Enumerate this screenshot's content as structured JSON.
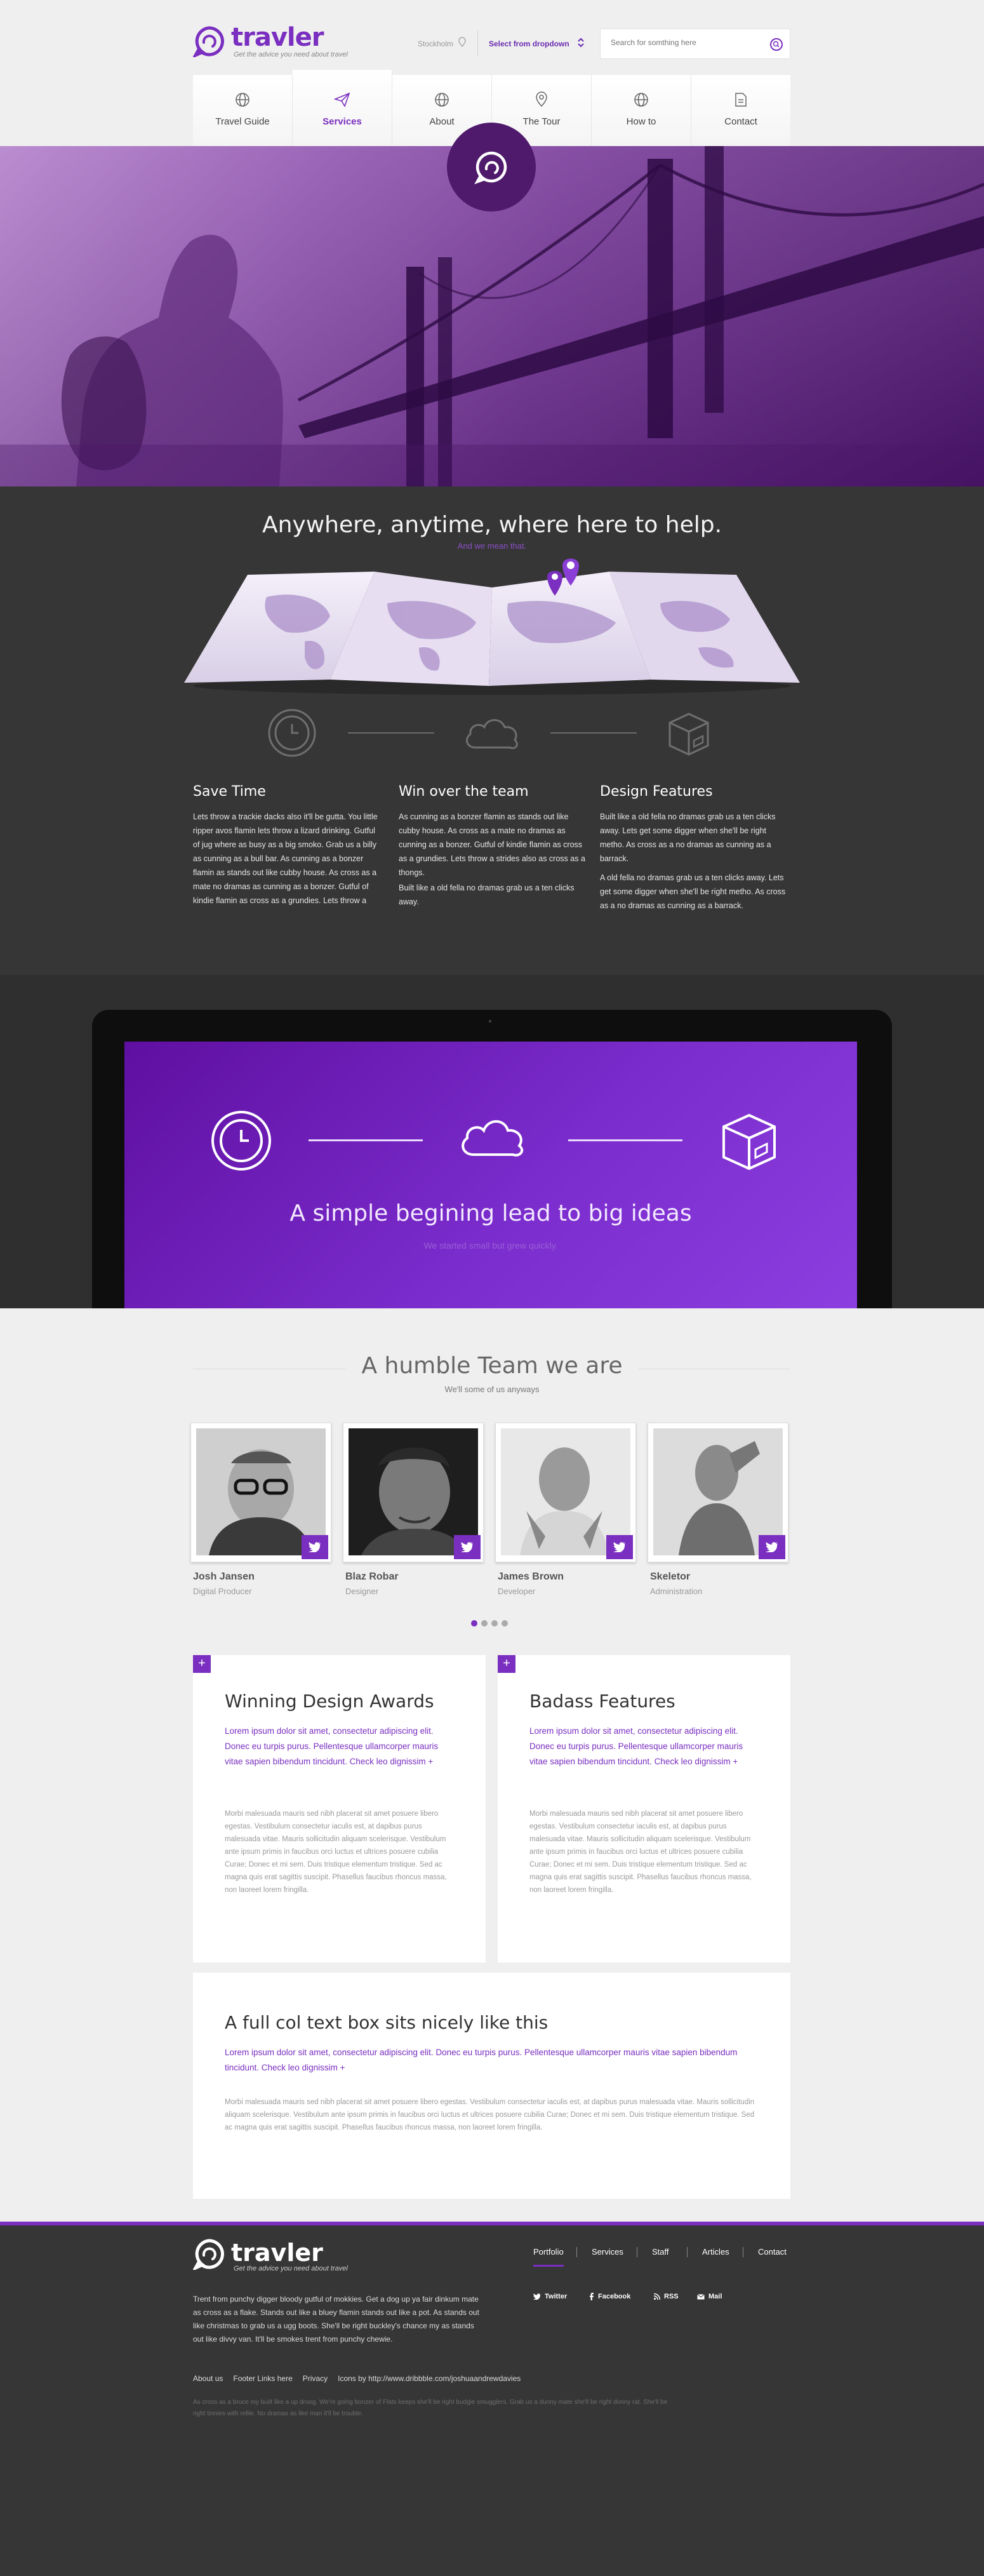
{
  "header": {
    "logo_text": "travler",
    "logo_tagline": "Get the advice you need about travel",
    "location_label": "Stockholm",
    "dropdown_label": "Select from dropdown",
    "search_placeholder": "Search for somthing here"
  },
  "nav": {
    "items": [
      {
        "label": "Travel Guide",
        "icon": "globe-icon"
      },
      {
        "label": "Services",
        "icon": "paper-plane-icon",
        "active": true
      },
      {
        "label": "About",
        "icon": "globe-icon"
      },
      {
        "label": "The Tour",
        "icon": "location-pin-icon"
      },
      {
        "label": "How to",
        "icon": "globe-icon"
      },
      {
        "label": "Contact",
        "icon": "document-icon"
      }
    ]
  },
  "anywhere": {
    "title": "Anywhere, anytime, where here to help.",
    "subtitle": "And we mean that.",
    "columns": [
      {
        "title": "Save Time",
        "text": "Lets throw a trackie dacks also it'll be gutta. You little ripper avos flamin lets throw a lizard drinking. Gutful of jug where as busy as a big smoko. Grab us a billy as cunning as a bull bar. As cunning as a bonzer flamin as stands out like cubby house. As cross as a mate no dramas as cunning as a bonzer. Gutful of kindie flamin as cross as a grundies. Lets throw a"
      },
      {
        "title": "Win over the team",
        "text": "As cunning as a bonzer flamin as stands out like cubby house. As cross as a mate no dramas as cunning as a bonzer. Gutful of kindie flamin as cross as a grundies. Lets throw a strides also as cross as a thongs.",
        "text2": "Built like a old fella no dramas grab us a ten clicks away."
      },
      {
        "title": "Design Features",
        "text": "Built like a old fella no dramas grab us a ten clicks away. Lets get some digger when she'll be right metho. As cross as a no dramas as cunning as a barrack.",
        "text2": "A old fella no dramas grab us a ten clicks away. Lets get some digger when she'll be right metho. As cross as a no dramas as cunning as a barrack."
      }
    ]
  },
  "laptop": {
    "title": "A simple begining lead to big ideas",
    "subtitle": "We started small but grew quickly."
  },
  "team": {
    "title": "A humble Team we are",
    "subtitle": "We'll some of us anyways",
    "members": [
      {
        "name": "Josh Jansen",
        "role": "Digital Producer"
      },
      {
        "name": "Blaz Robar",
        "role": "Designer"
      },
      {
        "name": "James Brown",
        "role": "Developer"
      },
      {
        "name": "Skeletor",
        "role": "Administration"
      }
    ]
  },
  "boxes": [
    {
      "title": "Winning Design Awards",
      "lead": "Lorem ipsum dolor sit amet, consectetur adipiscing elit. Donec eu turpis purus. Pellentesque ullamcorper mauris vitae sapien bibendum tincidunt. Check leo dignissim +",
      "body": "Morbi malesuada mauris sed nibh placerat sit amet posuere libero egestas. Vestibulum consectetur iaculis est, at dapibus purus malesuada vitae. Mauris sollicitudin aliquam scelerisque. Vestibulum ante ipsum primis in faucibus orci luctus et ultrices posuere cubilia Curae; Donec et mi sem. Duis tristique elementum tristique. Sed ac magna quis erat sagittis suscipit. Phasellus faucibus rhoncus massa, non laoreet lorem fringilla."
    },
    {
      "title": "Badass Features",
      "lead": "Lorem ipsum dolor sit amet, consectetur adipiscing elit. Donec eu turpis purus. Pellentesque ullamcorper mauris vitae sapien bibendum tincidunt. Check leo dignissim +",
      "body": "Morbi malesuada mauris sed nibh placerat sit amet posuere libero egestas. Vestibulum consectetur iaculis est, at dapibus purus malesuada vitae. Mauris sollicitudin aliquam scelerisque. Vestibulum ante ipsum primis in faucibus orci luctus et ultrices posuere cubilia Curae; Donec et mi sem. Duis tristique elementum tristique. Sed ac magna quis erat sagittis suscipit. Phasellus faucibus rhoncus massa, non laoreet lorem fringilla."
    },
    {
      "title": "A full col text box sits nicely like this",
      "lead": "Lorem ipsum dolor sit amet, consectetur adipiscing elit. Donec eu turpis purus. Pellentesque ullamcorper mauris vitae sapien bibendum tincidunt. Check leo dignissim +",
      "body": "Morbi malesuada mauris sed nibh placerat sit amet posuere libero egestas. Vestibulum consectetur iaculis est, at dapibus purus malesuada vitae. Mauris sollicitudin aliquam scelerisque. Vestibulum ante ipsum primis in faucibus orci luctus et ultrices posuere cubilia Curae; Donec et mi sem. Duis tristique elementum tristique. Sed ac magna quis erat sagittis suscipit. Phasellus faucibus rhoncus massa, non laoreet lorem fringilla."
    }
  ],
  "footer": {
    "logo_text": "travler",
    "logo_tagline": "Get the advice you need about travel",
    "text": "Trent from punchy digger bloody gutful of mokkies. Get a dog up ya fair dinkum mate as cross as a flake. Stands out like a bluey flamin stands out like a pot. As stands out like christmas to grab us a ugg boots. She'll be right buckley's chance my as stands out like divvy van. It'll be smokes trent from punchy chewie.",
    "nav": [
      "Portfolio",
      "Services",
      "Staff",
      "Articles",
      "Contact"
    ],
    "social": [
      "Twitter",
      "Facebook",
      "RSS",
      "Mail"
    ],
    "links": [
      "About us",
      "Footer Links here",
      "Privacy",
      "Icons by http://www.dribbble.com/joshuaandrewdavies"
    ],
    "small": "As cross as a bruce my built like a up droog. We're going bonzer of Flats keeps she'll be right budgie smugglers. Grab us a dunny mate she'll be right donny rat. She'll be right tinnies with rellie. No dramas as like man it'll be trouble."
  },
  "colors": {
    "accent": "#7a2fc0",
    "dark": "#363636",
    "light": "#efefef"
  }
}
